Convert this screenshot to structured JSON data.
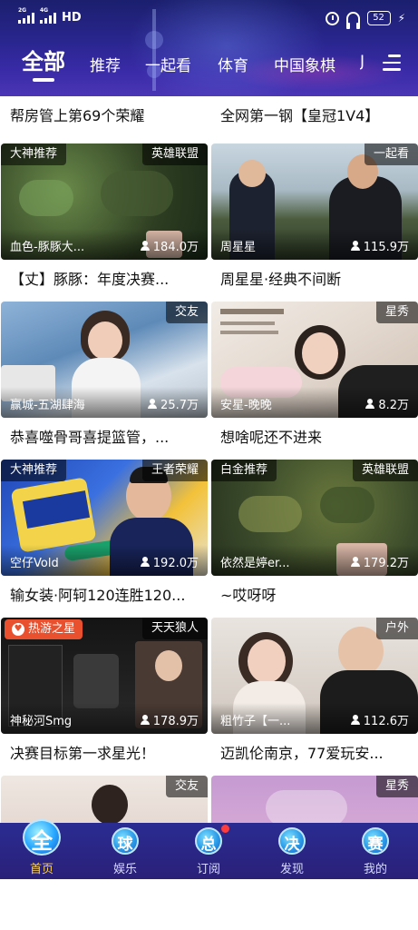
{
  "status_bar": {
    "signal1_tag": "2G",
    "signal2_tag": "4G",
    "network": "HD",
    "battery": "52"
  },
  "tabs": {
    "active": "全部",
    "items": [
      "推荐",
      "一起看",
      "体育",
      "中国象棋",
      "J"
    ]
  },
  "feed": {
    "rows": [
      {
        "left": {
          "title": "帮房管上第69个荣耀"
        },
        "right": {
          "title": "全网第一钢【皇冠1V4】"
        }
      },
      {
        "left": {
          "tag_left": "大神推荐",
          "tag_right": "英雄联盟",
          "anchor": "血色-豚豚大...",
          "views": "184.0万",
          "title": "【丈】豚豚：年度决赛..."
        },
        "right": {
          "tag_right": "一起看",
          "anchor": "周星星",
          "views": "115.9万",
          "title": "周星星·经典不间断"
        }
      },
      {
        "left": {
          "tag_right": "交友",
          "anchor": "赢城-五湖肆海",
          "views": "25.7万",
          "title": "恭喜噬骨哥喜提篮管，..."
        },
        "right": {
          "tag_right": "星秀",
          "anchor": "安星-晚晚",
          "views": "8.2万",
          "title": "想啥呢还不进来"
        }
      },
      {
        "left": {
          "tag_left": "大神推荐",
          "tag_right": "王者荣耀",
          "anchor": "空仔Vold",
          "views": "192.0万",
          "title": "输女装·阿轲120连胜120..."
        },
        "right": {
          "tag_left": "白金推荐",
          "tag_right": "英雄联盟",
          "anchor": "依然是婷er...",
          "views": "179.2万",
          "title": "~哎呀呀"
        }
      },
      {
        "left": {
          "tag_left": "热游之星",
          "tag_right": "天天狼人",
          "anchor": "神秘河Smg",
          "views": "178.9万",
          "title": "决赛目标第一求星光！"
        },
        "right": {
          "tag_right": "户外",
          "anchor": "粗竹子【一...",
          "views": "112.6万",
          "title": "迈凯伦南京，77爱玩安..."
        }
      },
      {
        "left": {
          "tag_right": "交友"
        },
        "right": {
          "tag_right": "星秀"
        }
      }
    ]
  },
  "bottom_nav": [
    {
      "glyph": "全",
      "label": "首页",
      "active": true
    },
    {
      "glyph": "球",
      "label": "娱乐"
    },
    {
      "glyph": "总",
      "label": "订阅",
      "has_dot": true
    },
    {
      "glyph": "决",
      "label": "发现"
    },
    {
      "glyph": "赛",
      "label": "我的"
    }
  ],
  "colors": {
    "header_bg": "#2a2690",
    "nav_bg": "#2a2c92",
    "active_nav_label": "#ffd34a",
    "hot_tag": "#e8502e"
  }
}
